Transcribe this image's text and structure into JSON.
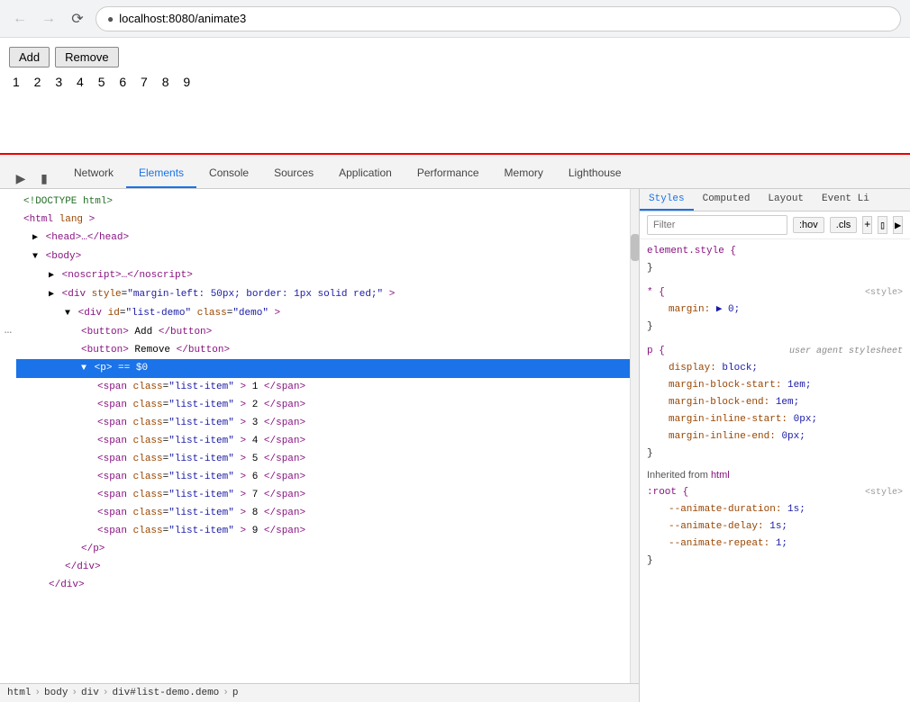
{
  "browser": {
    "back_disabled": true,
    "forward_disabled": true,
    "url": "localhost:8080/animate3"
  },
  "page": {
    "add_btn": "Add",
    "remove_btn": "Remove",
    "numbers": "1 2 3 4 5 6 7 8 9"
  },
  "devtools": {
    "tabs": [
      {
        "id": "elements-tab",
        "label": "Elements",
        "active": true
      },
      {
        "id": "console-tab",
        "label": "Console",
        "active": false
      },
      {
        "id": "sources-tab",
        "label": "Sources",
        "active": false
      },
      {
        "id": "network-tab",
        "label": "Network",
        "active": false
      },
      {
        "id": "application-tab",
        "label": "Application",
        "active": false
      },
      {
        "id": "performance-tab",
        "label": "Performance",
        "active": false
      },
      {
        "id": "memory-tab",
        "label": "Memory",
        "active": false
      },
      {
        "id": "lighthouse-tab",
        "label": "Lighthouse",
        "active": false
      }
    ],
    "dom": {
      "lines": [
        {
          "id": "doctype",
          "indent": 0,
          "html": "<!DOCTYPE html>",
          "selected": false
        },
        {
          "id": "html-tag",
          "indent": 0,
          "html": "<html lang>",
          "selected": false
        },
        {
          "id": "head-tag",
          "indent": 1,
          "html": "▶ <head>…</head>",
          "selected": false
        },
        {
          "id": "body-open",
          "indent": 1,
          "html": "▼ <body>",
          "selected": false
        },
        {
          "id": "noscript",
          "indent": 2,
          "html": "▶ <noscript>…</noscript>",
          "selected": false
        },
        {
          "id": "div-style",
          "indent": 2,
          "html": "▶ <div style=\"margin-left: 50px; border: 1px solid red;\">",
          "selected": false
        },
        {
          "id": "div-demo",
          "indent": 3,
          "html": "▼ <div id=\"list-demo\" class=\"demo\">",
          "selected": false
        },
        {
          "id": "btn-add",
          "indent": 4,
          "html": "<button>Add</button>",
          "selected": false
        },
        {
          "id": "btn-remove",
          "indent": 4,
          "html": "<button>Remove</button>",
          "selected": false
        },
        {
          "id": "p-selected",
          "indent": 4,
          "html": "▼ <p> == $0",
          "selected": true
        },
        {
          "id": "span1",
          "indent": 5,
          "html": "<span class=\"list-item\"> 1 </span>",
          "selected": false
        },
        {
          "id": "span2",
          "indent": 5,
          "html": "<span class=\"list-item\"> 2 </span>",
          "selected": false
        },
        {
          "id": "span3",
          "indent": 5,
          "html": "<span class=\"list-item\"> 3 </span>",
          "selected": false
        },
        {
          "id": "span4",
          "indent": 5,
          "html": "<span class=\"list-item\"> 4 </span>",
          "selected": false
        },
        {
          "id": "span5",
          "indent": 5,
          "html": "<span class=\"list-item\"> 5 </span>",
          "selected": false
        },
        {
          "id": "span6",
          "indent": 5,
          "html": "<span class=\"list-item\"> 6 </span>",
          "selected": false
        },
        {
          "id": "span7",
          "indent": 5,
          "html": "<span class=\"list-item\"> 7 </span>",
          "selected": false
        },
        {
          "id": "span8",
          "indent": 5,
          "html": "<span class=\"list-item\"> 8 </span>",
          "selected": false
        },
        {
          "id": "span9",
          "indent": 5,
          "html": "<span class=\"list-item\"> 9 </span>",
          "selected": false
        },
        {
          "id": "p-close",
          "indent": 4,
          "html": "</p>",
          "selected": false
        },
        {
          "id": "div-close1",
          "indent": 3,
          "html": "</div>",
          "selected": false
        },
        {
          "id": "div-close2",
          "indent": 2,
          "html": "</div>",
          "selected": false
        }
      ],
      "breadcrumb": [
        "html",
        "body",
        "div",
        "div#list-demo.demo",
        "p"
      ]
    },
    "styles": {
      "tabs": [
        "Styles",
        "Computed",
        "Layout",
        "Event Li"
      ],
      "active_tab": "Styles",
      "filter_placeholder": "Filter",
      "filter_value": "",
      "hov_btn": ":hov",
      "cls_btn": ".cls",
      "blocks": [
        {
          "selector": "element.style {",
          "source": "",
          "props": [],
          "close": "}"
        },
        {
          "selector": "* {",
          "source": "<style>",
          "props": [
            {
              "name": "margin:",
              "value": "▶ 0;"
            }
          ],
          "close": "}"
        },
        {
          "selector": "p {",
          "source": "user agent stylesheet",
          "props": [
            {
              "name": "display:",
              "value": "block;"
            },
            {
              "name": "margin-block-start:",
              "value": "1em;"
            },
            {
              "name": "margin-block-end:",
              "value": "1em;"
            },
            {
              "name": "margin-inline-start:",
              "value": "0px;"
            },
            {
              "name": "margin-inline-end:",
              "value": "0px;"
            }
          ],
          "close": "}"
        }
      ],
      "inherited": {
        "label": "Inherited from",
        "from": "html",
        "blocks": [
          {
            "selector": ":root {",
            "source": "<style>",
            "props": [
              {
                "name": "--animate-duration:",
                "value": "1s;"
              },
              {
                "name": "--animate-delay:",
                "value": "1s;"
              },
              {
                "name": "--animate-repeat:",
                "value": "1;"
              }
            ],
            "close": "}"
          }
        ]
      }
    }
  }
}
